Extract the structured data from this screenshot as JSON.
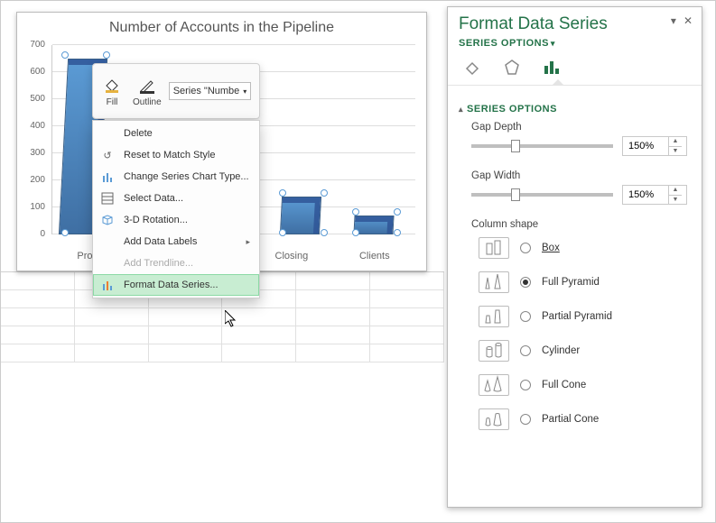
{
  "chart_data": {
    "type": "bar",
    "title": "Number of Accounts in the Pipeline",
    "categories": [
      "Prospects",
      "",
      "",
      "Closing",
      "Clients"
    ],
    "values": [
      650,
      0,
      0,
      140,
      70
    ],
    "ylim": [
      0,
      700
    ],
    "ticks": [
      0,
      100,
      200,
      300,
      400,
      500,
      600,
      700
    ],
    "series_name": "Series \"Numbe"
  },
  "mini_toolbar": {
    "fill_label": "Fill",
    "outline_label": "Outline",
    "series_selector": "Series \"Numbe"
  },
  "context_menu": {
    "delete": "Delete",
    "reset": "Reset to Match Style",
    "change_type": "Change Series Chart Type...",
    "select_data": "Select Data...",
    "rotation": "3-D Rotation...",
    "add_labels": "Add Data Labels",
    "add_trendline": "Add Trendline...",
    "format_series": "Format Data Series..."
  },
  "taskpane": {
    "title": "Format Data Series",
    "series_options_link": "SERIES OPTIONS",
    "section_title": "SERIES OPTIONS",
    "gap_depth_label": "Gap Depth",
    "gap_depth_value": "150%",
    "gap_width_label": "Gap Width",
    "gap_width_value": "150%",
    "column_shape_label": "Column shape",
    "shapes": {
      "box": "Box",
      "full_pyramid": "Full Pyramid",
      "partial_pyramid": "Partial Pyramid",
      "cylinder": "Cylinder",
      "full_cone": "Full Cone",
      "partial_cone": "Partial Cone"
    },
    "selected_shape": "full_pyramid"
  }
}
